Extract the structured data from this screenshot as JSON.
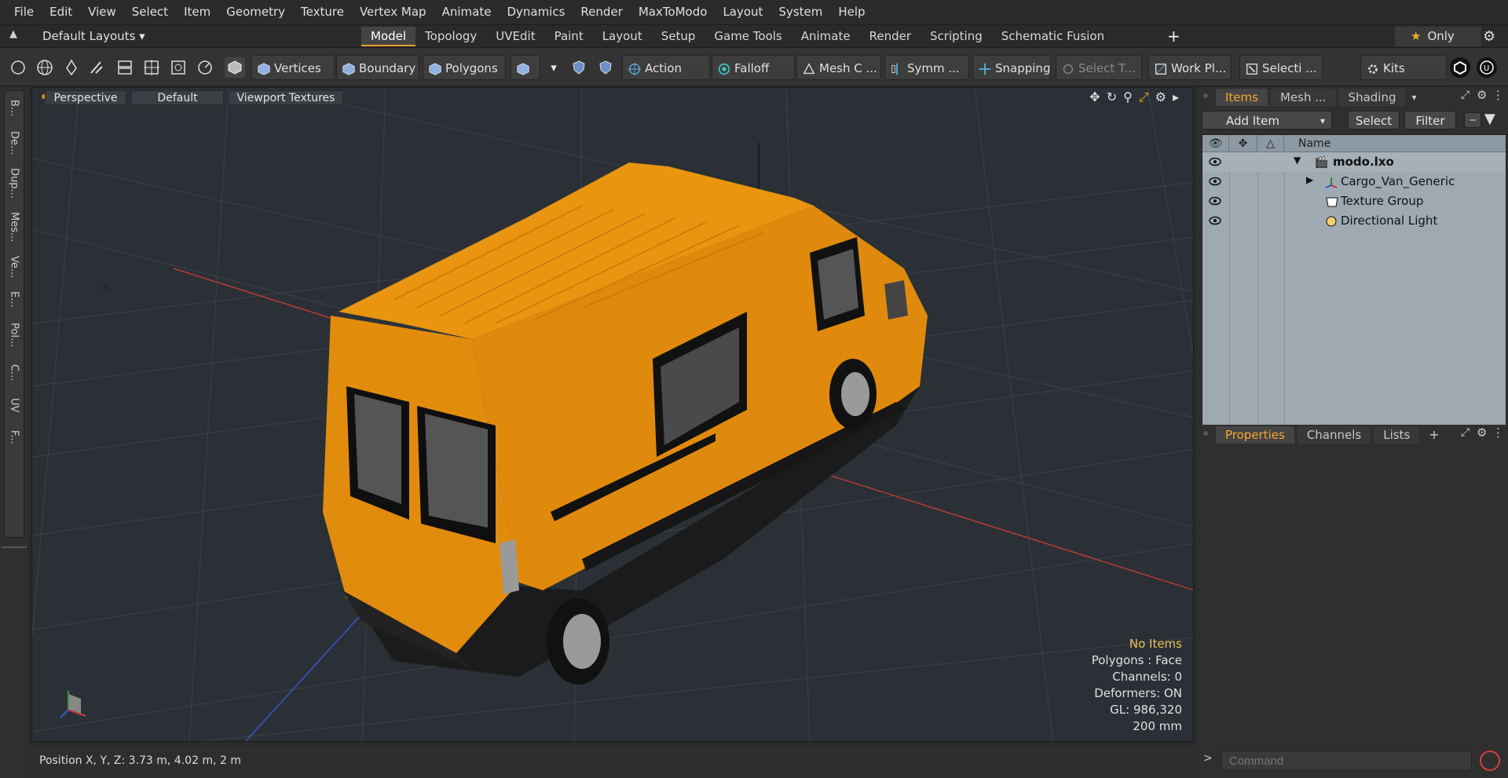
{
  "menu": [
    "File",
    "Edit",
    "View",
    "Select",
    "Item",
    "Geometry",
    "Texture",
    "Vertex Map",
    "Animate",
    "Dynamics",
    "Render",
    "MaxToModo",
    "Layout",
    "System",
    "Help"
  ],
  "layout_selector": "Default Layouts ▾",
  "layout_tabs": [
    "Model",
    "Topology",
    "UVEdit",
    "Paint",
    "Layout",
    "Setup",
    "Game Tools",
    "Animate",
    "Render",
    "Scripting",
    "Schematic Fusion"
  ],
  "active_layout_tab": "Model",
  "only_label": "Only",
  "toolbar": {
    "vertices": "Vertices",
    "boundary": "Boundary",
    "polygons": "Polygons",
    "action": "Action",
    "falloff": "Falloff",
    "mesh_constraints": "Mesh C ...",
    "symmetry": "Symm ...",
    "snapping": "Snapping",
    "select_through": "Select T...",
    "work_plane": "Work Pl...",
    "selection_sets": "Selecti ...",
    "kits": "Kits"
  },
  "left_tabs": [
    "B...",
    "De...",
    "Dup...",
    "Mes...",
    "Ve...",
    "E...",
    "Pol...",
    "C...",
    "UV",
    "F..."
  ],
  "viewport": {
    "view": "Perspective",
    "shading": "Default",
    "textures": "Viewport Textures",
    "info": {
      "selection": "No Items",
      "polygons": "Polygons : Face",
      "channels": "Channels: 0",
      "deformers": "Deformers: ON",
      "gl": "GL: 986,320",
      "grid": "200 mm"
    }
  },
  "status": {
    "position": "Position X, Y, Z:   3.73 m, 4.02 m, 2 m"
  },
  "items_panel": {
    "tabs": [
      "Items",
      "Mesh ...",
      "Shading"
    ],
    "add_item": "Add Item",
    "select": "Select",
    "filter": "Filter",
    "name_header": "Name",
    "items": [
      {
        "name": "modo.lxo",
        "bold": true
      },
      {
        "name": "Cargo_Van_Generic",
        "bold": false
      },
      {
        "name": "Texture Group",
        "bold": false
      },
      {
        "name": "Directional Light",
        "bold": false
      }
    ]
  },
  "properties_panel": {
    "tabs": [
      "Properties",
      "Channels",
      "Lists"
    ]
  },
  "command_placeholder": "Command",
  "colors": {
    "accent": "#f0a030",
    "van": "#e8940f",
    "viewport_bg": "#2a3035",
    "item_list_bg": "#9ea9b2"
  }
}
